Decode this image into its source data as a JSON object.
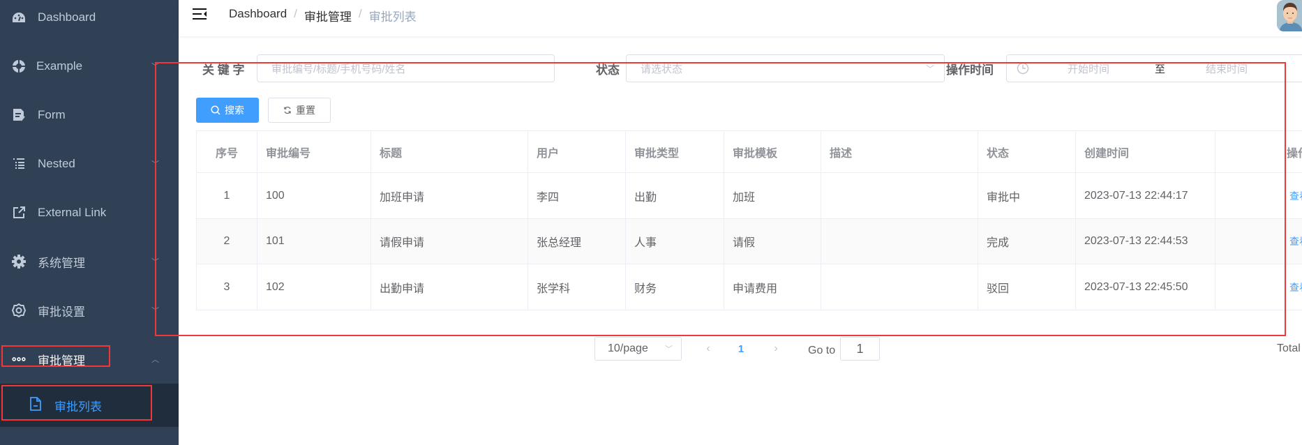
{
  "sidebar": {
    "items": [
      {
        "label": "Dashboard",
        "icon": "dashboard-icon",
        "has_children": false
      },
      {
        "label": "Example",
        "icon": "example-icon",
        "has_children": true
      },
      {
        "label": "Form",
        "icon": "form-icon",
        "has_children": false
      },
      {
        "label": "Nested",
        "icon": "nested-icon",
        "has_children": true
      },
      {
        "label": "External Link",
        "icon": "external-link-icon",
        "has_children": false
      },
      {
        "label": "系统管理",
        "icon": "gear-icon",
        "has_children": true
      },
      {
        "label": "审批设置",
        "icon": "settings-icon",
        "has_children": true
      },
      {
        "label": "审批管理",
        "icon": "more-icon",
        "has_children": true,
        "expanded": true
      }
    ],
    "submenu": {
      "label": "审批列表",
      "icon": "document-icon",
      "active": true
    },
    "colors": {
      "bg": "#304156",
      "submenu_bg": "#1f2d3d",
      "text": "#bfcbd9",
      "active": "#409eff"
    }
  },
  "navbar": {
    "breadcrumb": [
      "Dashboard",
      "审批管理",
      "审批列表"
    ],
    "separator": "/"
  },
  "filters": {
    "keyword": {
      "label": "关 键 字",
      "placeholder": "审批编号/标题/手机号码/姓名",
      "value": ""
    },
    "status": {
      "label": "状态",
      "placeholder": "请选状态",
      "value": ""
    },
    "time": {
      "label": "操作时间",
      "start_placeholder": "开始时间",
      "range_separator": "至",
      "end_placeholder": "结束时间"
    },
    "search_button": "搜索",
    "reset_button": "重置"
  },
  "table": {
    "columns": [
      "序号",
      "审批编号",
      "标题",
      "用户",
      "审批类型",
      "审批模板",
      "描述",
      "状态",
      "创建时间",
      "操作"
    ],
    "rows": [
      [
        "1",
        "100",
        "加班申请",
        "李四",
        "出勤",
        "加班",
        "",
        "审批中",
        "2023-07-13 22:44:17",
        "查看"
      ],
      [
        "2",
        "101",
        "请假申请",
        "张总经理",
        "人事",
        "请假",
        "",
        "完成",
        "2023-07-13 22:44:53",
        "查看"
      ],
      [
        "3",
        "102",
        "出勤申请",
        "张学科",
        "财务",
        "申请费用",
        "",
        "驳回",
        "2023-07-13 22:45:50",
        "查看"
      ]
    ]
  },
  "pagination": {
    "page_size": "10/page",
    "current_page": "1",
    "goto_label": "Go to",
    "goto_value": "1",
    "total_label": "Total"
  },
  "accent_color": "#409eff",
  "annotation_color": "#f1373a"
}
